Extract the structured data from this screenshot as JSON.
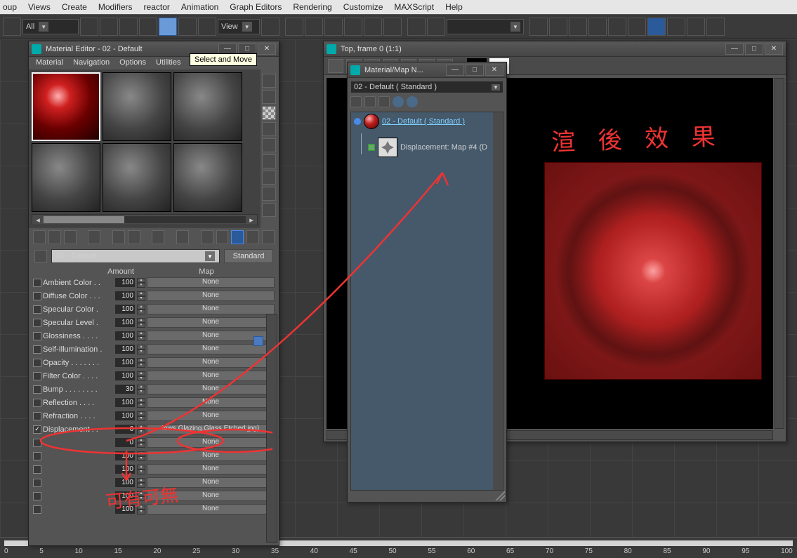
{
  "main_menu": {
    "items": [
      "oup",
      "Views",
      "Create",
      "Modifiers",
      "reactor",
      "Animation",
      "Graph Editors",
      "Rendering",
      "Customize",
      "MAXScript",
      "Help"
    ]
  },
  "toolbar": {
    "filter_label": "All",
    "view_label": "View",
    "tooltip": "Select and Move"
  },
  "material_editor": {
    "title": "Material Editor - 02 - Default",
    "menu": [
      "Material",
      "Navigation",
      "Options",
      "Utilities"
    ],
    "material_name": "02 - Default",
    "material_type": "Standard",
    "headers": {
      "amount": "Amount",
      "map": "Map"
    },
    "none_label": "None",
    "rows": [
      {
        "checked": false,
        "label": "Ambient Color . .",
        "amount": "100",
        "map": "None"
      },
      {
        "checked": false,
        "label": "Diffuse Color . . .",
        "amount": "100",
        "map": "None"
      },
      {
        "checked": false,
        "label": "Specular Color .",
        "amount": "100",
        "map": "None"
      },
      {
        "checked": false,
        "label": "Specular Level .",
        "amount": "100",
        "map": "None"
      },
      {
        "checked": false,
        "label": "Glossiness . . . .",
        "amount": "100",
        "map": "None"
      },
      {
        "checked": false,
        "label": "Self-Illumination .",
        "amount": "100",
        "map": "None"
      },
      {
        "checked": false,
        "label": "Opacity . . . . . . .",
        "amount": "100",
        "map": "None"
      },
      {
        "checked": false,
        "label": "Filter Color . . . .",
        "amount": "100",
        "map": "None"
      },
      {
        "checked": false,
        "label": "Bump . . . . . . . .",
        "amount": "30",
        "map": "None"
      },
      {
        "checked": false,
        "label": "Reflection . . . .",
        "amount": "100",
        "map": "None"
      },
      {
        "checked": false,
        "label": "Refraction . . . .",
        "amount": "100",
        "map": "None"
      },
      {
        "checked": true,
        "label": "Displacement . .",
        "amount": "6",
        "map": "lows.Glazing.Glass.Etched.jpg)"
      },
      {
        "checked": false,
        "label": "",
        "amount": "0",
        "map": "None",
        "dim": true
      },
      {
        "checked": false,
        "label": "",
        "amount": "100",
        "map": "None",
        "dim": true
      },
      {
        "checked": false,
        "label": "",
        "amount": "100",
        "map": "None",
        "dim": true
      },
      {
        "checked": false,
        "label": "",
        "amount": "100",
        "map": "None",
        "dim": true
      },
      {
        "checked": false,
        "label": "",
        "amount": "100",
        "map": "None",
        "dim": true
      },
      {
        "checked": false,
        "label": "",
        "amount": "100",
        "map": "None",
        "dim": true
      }
    ]
  },
  "render_window": {
    "title": "Top, frame 0 (1:1)",
    "annotation": "渲 後 效 果"
  },
  "navigator": {
    "title": "Material/Map N...",
    "combo": "02 - Default  ( Standard )",
    "root_label": "02 - Default  ( Standard )",
    "child_label": "Displacement: Map #4 (D"
  },
  "annotations": {
    "bottom_text": "可有可無"
  },
  "ruler": {
    "ticks": [
      "0",
      "5",
      "10",
      "15",
      "20",
      "25",
      "30",
      "35",
      "40",
      "45",
      "50",
      "55",
      "60",
      "65",
      "70",
      "75",
      "80",
      "85",
      "90",
      "95",
      "100"
    ]
  }
}
